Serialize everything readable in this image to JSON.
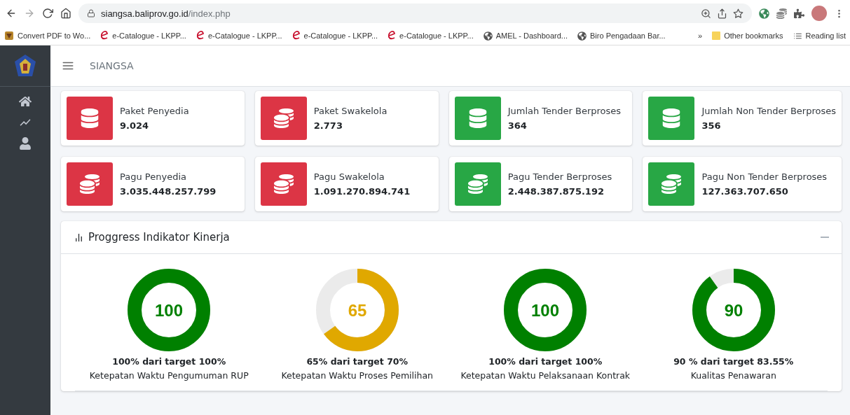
{
  "browser": {
    "url_host": "siangsa.baliprov.go.id",
    "url_path": "/index.php",
    "bookmarks": [
      {
        "kind": "pdf",
        "label": "Convert PDF to Wo..."
      },
      {
        "kind": "e",
        "label": "e-Catalogue - LKPP..."
      },
      {
        "kind": "e",
        "label": "e-Catalogue - LKPP..."
      },
      {
        "kind": "e",
        "label": "e-Catalogue - LKPP..."
      },
      {
        "kind": "e",
        "label": "e-Catalogue - LKPP..."
      },
      {
        "kind": "globe",
        "label": "AMEL - Dashboard..."
      },
      {
        "kind": "globe",
        "label": "Biro Pengadaan Bar..."
      }
    ],
    "overflow": "»",
    "other_bookmarks": "Other bookmarks",
    "reading_list": "Reading list"
  },
  "header": {
    "title": "SIANGSA"
  },
  "sidebar": {
    "items": [
      {
        "kind": "home"
      },
      {
        "kind": "chart"
      },
      {
        "kind": "user"
      }
    ]
  },
  "cards": [
    {
      "label": "Paket Penyedia",
      "value": "9.024",
      "kind": "stack",
      "color": "#dc3545"
    },
    {
      "label": "Paket Swakelola",
      "value": "2.773",
      "kind": "coins",
      "color": "#dc3545"
    },
    {
      "label": "Jumlah Tender Berproses",
      "value": "364",
      "kind": "stack",
      "color": "#28a745"
    },
    {
      "label": "Jumlah Non Tender Berproses",
      "value": "356",
      "kind": "stack",
      "color": "#28a745"
    },
    {
      "label": "Pagu Penyedia",
      "value": "3.035.448.257.799",
      "kind": "coins",
      "color": "#dc3545"
    },
    {
      "label": "Pagu Swakelola",
      "value": "1.091.270.894.741",
      "kind": "coins",
      "color": "#dc3545"
    },
    {
      "label": "Pagu Tender Berproses",
      "value": "2.448.387.875.192",
      "kind": "coins",
      "color": "#28a745"
    },
    {
      "label": "Pagu Non Tender Berproses",
      "value": "127.363.707.650",
      "kind": "coins",
      "color": "#28a745"
    }
  ],
  "panel": {
    "title": "Proggress Indikator Kinerja",
    "indicators": [
      {
        "value": "100",
        "level": 1,
        "color": "#008000",
        "summary": "100% dari target 100%",
        "label": "Ketepatan Waktu Pengumuman RUP"
      },
      {
        "value": "65",
        "level": 0.65,
        "color": "#e0a800",
        "summary": "65% dari target 70%",
        "label": "Ketepatan Waktu Proses Pemilihan"
      },
      {
        "value": "100",
        "level": 1,
        "color": "#008000",
        "summary": "100% dari target 100%",
        "label": "Ketepatan Waktu Pelaksanaan Kontrak"
      },
      {
        "value": "90",
        "level": 0.9,
        "color": "#008000",
        "summary": "90 % dari target 83.55%",
        "label": "Kualitas Penawaran"
      }
    ]
  }
}
